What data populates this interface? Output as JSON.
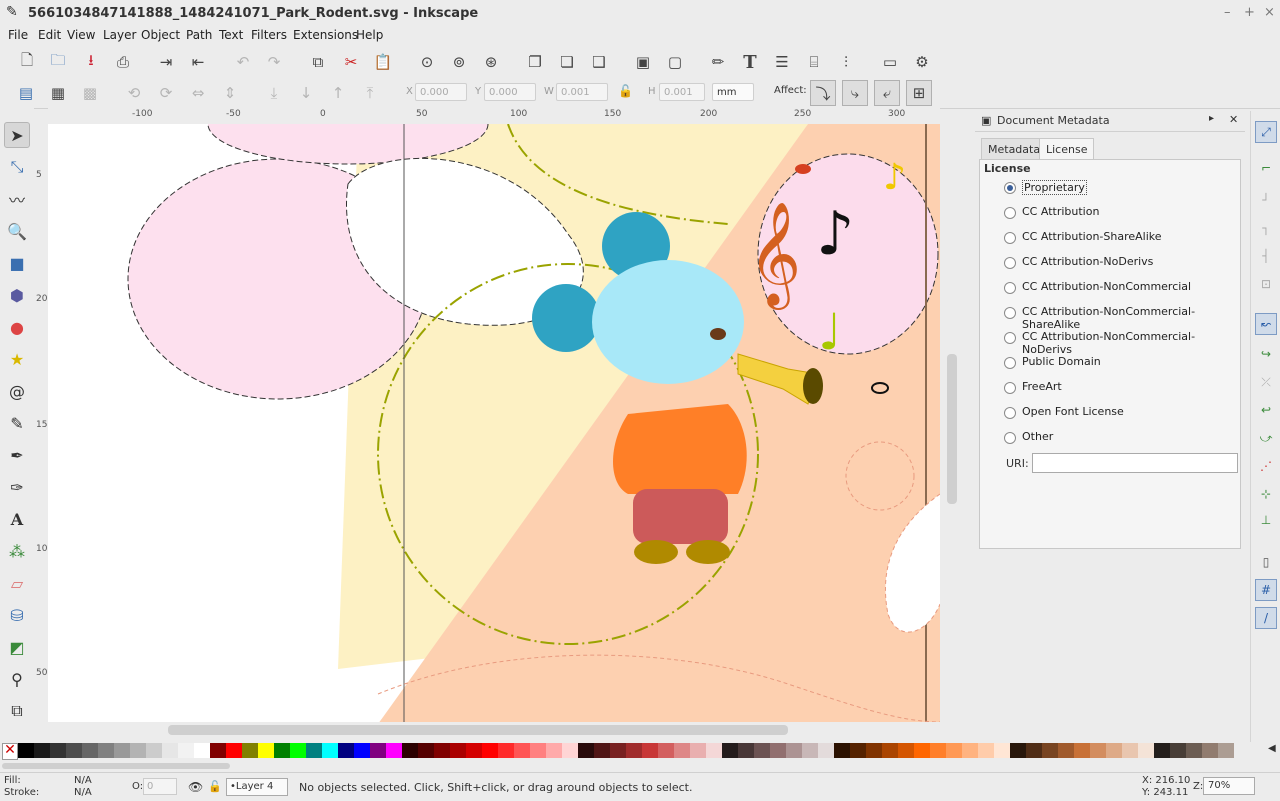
{
  "window": {
    "title": "5661034847141888_1484241071_Park_Rodent.svg - Inkscape",
    "controls": [
      "–",
      "+",
      "×"
    ]
  },
  "menu": [
    "File",
    "Edit",
    "View",
    "Layer",
    "Object",
    "Path",
    "Text",
    "Filters",
    "Extensions",
    "Help"
  ],
  "command_bar_icons": [
    "new-icon",
    "open-icon",
    "save-icon",
    "print-icon",
    "import-icon",
    "export-icon",
    "undo-icon",
    "redo-icon",
    "copy-icon",
    "cut-icon",
    "paste-icon",
    "zoom-selection-icon",
    "zoom-drawing-icon",
    "zoom-page-icon",
    "duplicate-icon",
    "clone-icon",
    "unlink-clone-icon",
    "group-icon",
    "ungroup-icon",
    "fill-stroke-icon",
    "text-font-icon",
    "layers-icon",
    "xml-editor-icon",
    "align-icon",
    "document-properties-icon",
    "preferences-icon"
  ],
  "controls": {
    "x_label": "X",
    "x_value": "0.000",
    "y_label": "Y",
    "y_value": "0.000",
    "w_label": "W",
    "w_value": "0.001",
    "h_label": "H",
    "h_value": "0.001",
    "unit": "mm",
    "affect_label": "Affect:"
  },
  "tools": [
    "selector",
    "node",
    "tweak",
    "zoom",
    "rectangle",
    "3dbox",
    "ellipse",
    "star",
    "spiral",
    "pencil",
    "pen",
    "calligraphy",
    "text",
    "spray",
    "eraser",
    "paint-bucket",
    "gradient",
    "dropper",
    "connector"
  ],
  "active_tool": "selector",
  "ruler": {
    "h_labels": [
      "-100",
      "-50",
      "0",
      "50",
      "100",
      "150",
      "200",
      "250",
      "300"
    ],
    "v_labels": [
      "5",
      "200",
      "150",
      "100",
      "50"
    ]
  },
  "dock": {
    "title": "Document Metadata",
    "tabs": [
      "Metadata",
      "License"
    ],
    "active_tab": "License",
    "section_title": "License",
    "licenses": [
      "Proprietary",
      "CC Attribution",
      "CC Attribution-ShareAlike",
      "CC Attribution-NoDerivs",
      "CC Attribution-NonCommercial",
      "CC Attribution-NonCommercial-ShareAlike",
      "CC Attribution-NonCommercial-NoDerivs",
      "Public Domain",
      "FreeArt",
      "Open Font License",
      "Other"
    ],
    "selected_license": "Proprietary",
    "uri_label": "URI:",
    "uri_value": ""
  },
  "palette": [
    "#000000",
    "#1a1a1a",
    "#333333",
    "#4d4d4d",
    "#666666",
    "#808080",
    "#999999",
    "#b3b3b3",
    "#cccccc",
    "#e6e6e6",
    "#f2f2f2",
    "#ffffff",
    "#800000",
    "#ff0000",
    "#808000",
    "#ffff00",
    "#008000",
    "#00ff00",
    "#008080",
    "#00ffff",
    "#000080",
    "#0000ff",
    "#800080",
    "#ff00ff",
    "#2b0000",
    "#550000",
    "#800000",
    "#aa0000",
    "#d40000",
    "#ff0000",
    "#ff2a2a",
    "#ff5555",
    "#ff8080",
    "#ffaaaa",
    "#ffd5d5",
    "#280b0b",
    "#501616",
    "#782121",
    "#a02c2c",
    "#c83737",
    "#d35f5f",
    "#de8787",
    "#e9afaf",
    "#f4d7d7",
    "#241c1c",
    "#483737",
    "#6c5353",
    "#916f6f",
    "#ac9393",
    "#c8b7b7",
    "#e3dbdb",
    "#2b1100",
    "#552200",
    "#803300",
    "#aa4400",
    "#d45500",
    "#ff6600",
    "#ff7f2a",
    "#ff9955",
    "#ffb380",
    "#ffccaa",
    "#ffe6d5",
    "#28170b",
    "#502d16",
    "#784421",
    "#a05a2c",
    "#c87137",
    "#d38d5f",
    "#deaa87",
    "#e9c6af",
    "#f4e3d7",
    "#241f1c",
    "#483e37",
    "#6c5d53",
    "#917c6f",
    "#ac9d93"
  ],
  "status": {
    "fill_label": "Fill:",
    "fill_value": "N/A",
    "stroke_label": "Stroke:",
    "stroke_value": "N/A",
    "opacity_label": "O:",
    "opacity_value": "0",
    "layer": "•Layer 4",
    "message": "No objects selected. Click, Shift+click, or drag around objects to select.",
    "x_readout": "X:  216.10",
    "y_readout": "Y:  243.11",
    "zoom_label": "Z:",
    "zoom_value": "70%"
  }
}
